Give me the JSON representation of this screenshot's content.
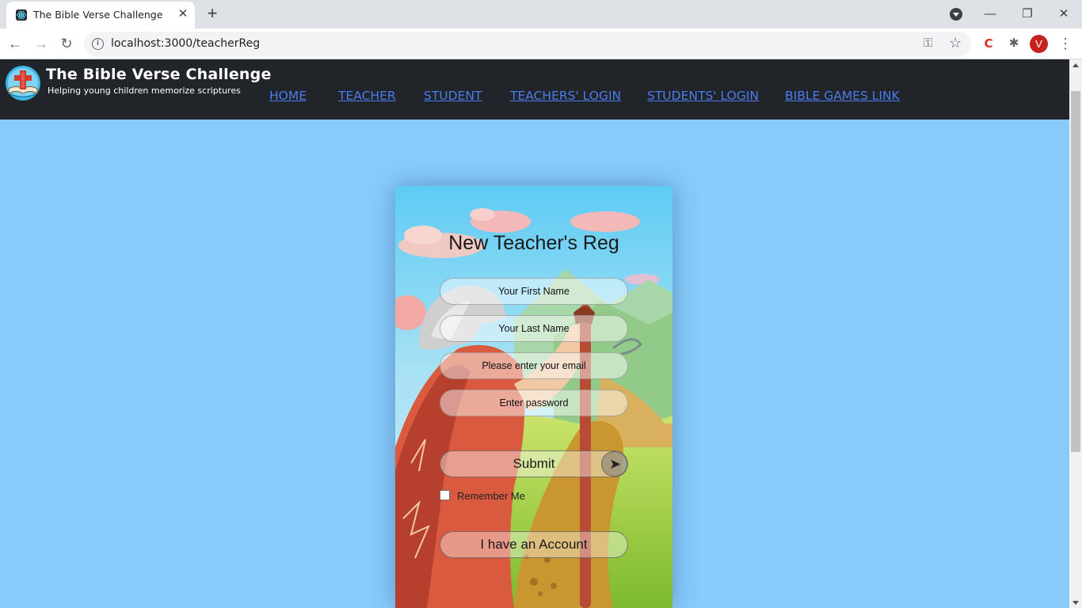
{
  "browser": {
    "tab_title": "The Bible Verse Challenge",
    "tab_close": "✕",
    "new_tab": "+",
    "url": "localhost:3000/teacherReg",
    "avatar_letter": "V",
    "window_controls": {
      "minimize": "—",
      "restore": "❐",
      "close": "✕"
    }
  },
  "navbar": {
    "brand_title": "The Bible Verse Challenge",
    "brand_subtitle": "Helping young children memorize scriptures",
    "links": [
      "HOME",
      "TEACHER",
      "STUDENT",
      "TEACHERS' LOGIN",
      "STUDENTS' LOGIN",
      "BIBLE GAMES LINK"
    ],
    "link_color": "#4a7cf0",
    "background": "#212529"
  },
  "form": {
    "title": "New Teacher's Reg",
    "first_name_placeholder": "Your First Name",
    "last_name_placeholder": "Your Last Name",
    "email_placeholder": "Please enter your email",
    "password_placeholder": "Enter password",
    "submit_label": "Submit",
    "remember_label": "Remember Me",
    "remember_checked": false,
    "account_button_label": "I have an Account"
  },
  "colors": {
    "page_background": "#87cbfb"
  }
}
